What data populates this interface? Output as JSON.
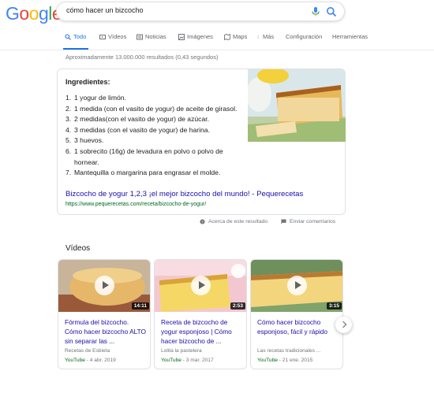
{
  "logo": {
    "letters": [
      "G",
      "o",
      "o",
      "g",
      "l",
      "e"
    ],
    "colors": [
      "#4285f4",
      "#ea4335",
      "#fbbc05",
      "#4285f4",
      "#34a853",
      "#ea4335"
    ]
  },
  "search": {
    "query": "cómo hacer un bizcocho",
    "mic_icon": "mic-icon",
    "search_icon": "search-icon"
  },
  "tabs": [
    {
      "label": "Todo",
      "icon": "search-icon",
      "active": true
    },
    {
      "label": "Vídeos",
      "icon": "video-icon"
    },
    {
      "label": "Noticias",
      "icon": "news-icon"
    },
    {
      "label": "Imágenes",
      "icon": "image-icon"
    },
    {
      "label": "Maps",
      "icon": "map-icon"
    },
    {
      "label": "Más",
      "icon": "more-icon"
    },
    {
      "label": "Configuración"
    },
    {
      "label": "Herramientas"
    }
  ],
  "result_stats": "Aproximadamente 13.000.000 resultados (0,43 segundos)",
  "snippet": {
    "title": "Ingredientes:",
    "items": [
      "1 yogur de limón.",
      "1 medida (con el vasito de yogur) de aceite de girasol.",
      "2 medidas(con el vasito de yogur) de azúcar.",
      "3 medidas (con el vasito de yogur) de harina.",
      "3 huevos.",
      "1 sobrecito (16g) de levadura en polvo o polvo de hornear.",
      "Mantequilla o margarina para engrasar el molde."
    ],
    "numbers": [
      "1.",
      "2.",
      "3.",
      "4.",
      "5.",
      "6.",
      "7."
    ],
    "link_title": "Bizcocho de yogur 1,2,3 ¡el mejor bizcocho del mundo! - Pequerecetas",
    "url": "https://www.pequerecetas.com/receta/bizcocho-de-yogur/"
  },
  "feedback": {
    "about": "Acerca de este resultado",
    "send": "Enviar comentarios"
  },
  "videos": {
    "heading": "Vídeos",
    "cards": [
      {
        "title": "Fórmula del bizcocho. Cómo hacer bizcocho ALTO sin separar las ...",
        "channel": "Recetas de Esbieta",
        "source": "YouTube",
        "date": "- 4 abr. 2019",
        "duration": "14:11"
      },
      {
        "title": "Receta de bizcocho de yogur esponjoso | Cómo hacer bizcocho de ...",
        "channel": "Lolita la pastelera",
        "source": "YouTube",
        "date": "- 3 mar. 2017",
        "duration": "2:53"
      },
      {
        "title": "Cómo hacer bizcocho esponjoso, fácil y rápido",
        "channel": "Las recetas tradicionales ...",
        "source": "YouTube",
        "date": "- 21 ene. 2015",
        "duration": "3:15"
      }
    ],
    "next_icon": "chevron-right-icon"
  },
  "colors": {
    "link": "#1a0dab",
    "url_green": "#006621",
    "tab_active": "#1a73e8"
  }
}
